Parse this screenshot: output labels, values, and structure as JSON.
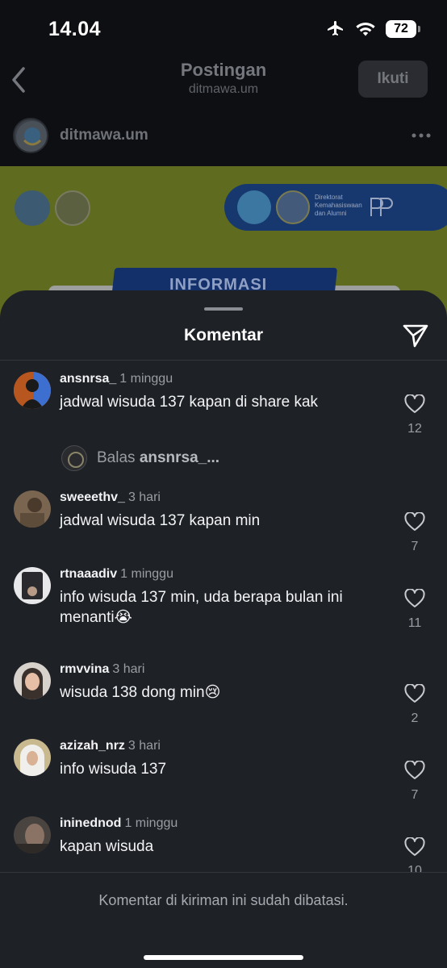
{
  "status_bar": {
    "time": "14.04",
    "battery": "72"
  },
  "post_header": {
    "title": "Postingan",
    "subtitle": "ditmawa.um",
    "follow_label": "Ikuti"
  },
  "author": {
    "name": "ditmawa.um"
  },
  "post_image": {
    "pill_text": "Direktorat Kemahasiswaan dan Alumni",
    "banner_text": "INFORMASI"
  },
  "sheet": {
    "title": "Komentar"
  },
  "comments": [
    {
      "user": "ansnrsa_",
      "time": "1 minggu",
      "text": "jadwal wisuda 137 kapan di share kak",
      "likes": "12"
    },
    {
      "user": "sweeethv_",
      "time": "3 hari",
      "text": "jadwal wisuda 137 kapan min",
      "likes": "7"
    },
    {
      "user": "rtnaaadiv",
      "time": "1 minggu",
      "text": "info wisuda 137 min, uda berapa bulan ini menanti😭",
      "likes": "11"
    },
    {
      "user": "rmvvina",
      "time": "3 hari",
      "text": "wisuda 138 dong min😢",
      "likes": "2"
    },
    {
      "user": "azizah_nrz",
      "time": "3 hari",
      "text": "info wisuda 137",
      "likes": "7"
    },
    {
      "user": "ininednod",
      "time": "1 minggu",
      "text": "kapan wisuda",
      "likes": "10"
    }
  ],
  "reply": {
    "prefix": "Balas",
    "user": "ansnrsa_..."
  },
  "footer": {
    "limited_text": "Komentar di kiriman ini sudah dibatasi."
  },
  "icons": {
    "back": "chevron-left-icon",
    "more": "more-horizontal-icon",
    "share": "send-icon",
    "like": "heart-icon",
    "airplane": "airplane-icon",
    "wifi": "wifi-icon"
  },
  "colors": {
    "sheet_bg": "#1e2126",
    "text": "#f2f3f5",
    "muted": "#9a9da3",
    "post_image_bg": "#5f6b1f"
  }
}
